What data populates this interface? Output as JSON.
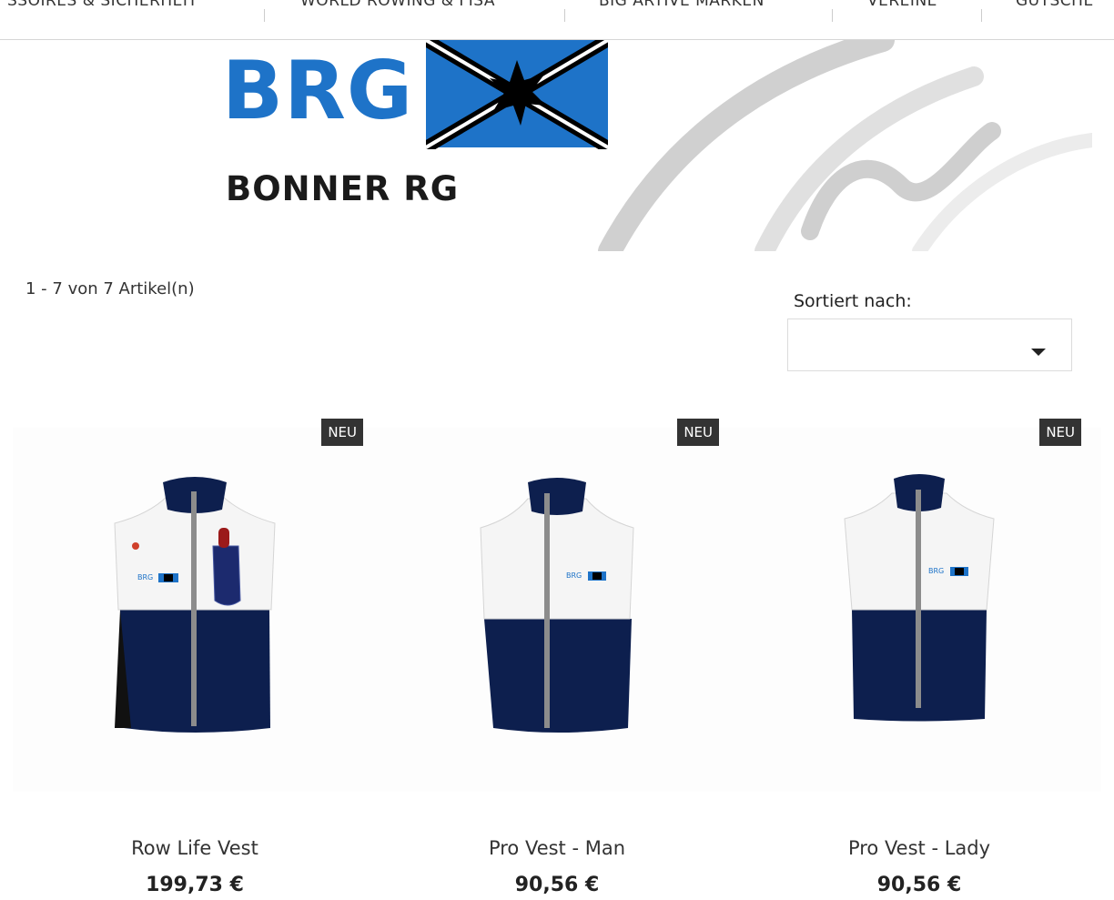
{
  "nav": {
    "items": [
      "SSOIRES & SICHERHEIT",
      "WORLD ROWING & FISA",
      "BIG ARTIVE MARKEN",
      "VEREINE",
      "GUTSCHE"
    ]
  },
  "banner": {
    "logo_text": "BRG",
    "club_name": "BONNER RG",
    "colors": {
      "brand_blue": "#1e73c8",
      "navy": "#0d1f4e"
    }
  },
  "listing": {
    "count_text": "1 - 7 von 7 Artikel(n)",
    "sort_label": "Sortiert nach:",
    "sort_value": ""
  },
  "products": [
    {
      "badge": "NEU",
      "name": "Row Life Vest",
      "price": "199,73 €",
      "image": "vest-with-pocket"
    },
    {
      "badge": "NEU",
      "name": "Pro Vest - Man",
      "price": "90,56 €",
      "image": "vest-man"
    },
    {
      "badge": "NEU",
      "name": "Pro Vest - Lady",
      "price": "90,56 €",
      "image": "vest-lady"
    }
  ]
}
